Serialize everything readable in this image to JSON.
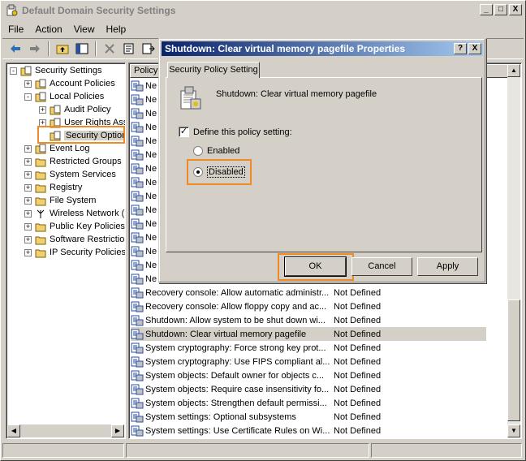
{
  "window": {
    "title": "Default Domain Security Settings",
    "min_label": "_",
    "max_label": "□",
    "close_label": "X"
  },
  "menu": [
    "File",
    "Action",
    "View",
    "Help"
  ],
  "tree": {
    "items": [
      {
        "label": "Security Settings",
        "level": 0,
        "expander": "-"
      },
      {
        "label": "Account Policies",
        "level": 1,
        "expander": "+"
      },
      {
        "label": "Local Policies",
        "level": 1,
        "expander": "-"
      },
      {
        "label": "Audit Policy",
        "level": 2,
        "expander": "+"
      },
      {
        "label": "User Rights Assig",
        "level": 2,
        "expander": "+"
      },
      {
        "label": "Security Options",
        "level": 2,
        "expander": ""
      },
      {
        "label": "Event Log",
        "level": 1,
        "expander": "+"
      },
      {
        "label": "Restricted Groups",
        "level": 1,
        "expander": "+"
      },
      {
        "label": "System Services",
        "level": 1,
        "expander": "+"
      },
      {
        "label": "Registry",
        "level": 1,
        "expander": "+"
      },
      {
        "label": "File System",
        "level": 1,
        "expander": "+"
      },
      {
        "label": "Wireless Network (IEE",
        "level": 1,
        "expander": "+"
      },
      {
        "label": "Public Key Policies",
        "level": 1,
        "expander": "+"
      },
      {
        "label": "Software Restriction I",
        "level": 1,
        "expander": "+"
      },
      {
        "label": "IP Security Policies on",
        "level": 1,
        "expander": "+"
      }
    ]
  },
  "list": {
    "header_policy": "Policy",
    "partial_label": "Ne",
    "partial_count": 15,
    "rows": [
      {
        "policy": "Recovery console: Allow automatic administr...",
        "setting": "Not Defined"
      },
      {
        "policy": "Recovery console: Allow floppy copy and ac...",
        "setting": "Not Defined"
      },
      {
        "policy": "Shutdown: Allow system to be shut down wi...",
        "setting": "Not Defined"
      },
      {
        "policy": "Shutdown: Clear virtual memory pagefile",
        "setting": "Not Defined",
        "selected": true
      },
      {
        "policy": "System cryptography: Force strong key prot...",
        "setting": "Not Defined"
      },
      {
        "policy": "System cryptography: Use FIPS compliant al...",
        "setting": "Not Defined"
      },
      {
        "policy": "System objects: Default owner for objects c...",
        "setting": "Not Defined"
      },
      {
        "policy": "System objects: Require case insensitivity fo...",
        "setting": "Not Defined"
      },
      {
        "policy": "System objects: Strengthen default permissi...",
        "setting": "Not Defined"
      },
      {
        "policy": "System settings: Optional subsystems",
        "setting": "Not Defined"
      },
      {
        "policy": "System settings: Use Certificate Rules on Wi...",
        "setting": "Not Defined"
      }
    ]
  },
  "dialog": {
    "title": "Shutdown: Clear virtual memory pagefile Properties",
    "help_label": "?",
    "close_label": "X",
    "tab_label": "Security Policy Setting",
    "policy_name": "Shutdown: Clear virtual memory pagefile",
    "define_label": "Define this policy setting:",
    "define_checked": true,
    "enabled_label": "Enabled",
    "disabled_label": "Disabled",
    "selected_option": "Disabled",
    "ok_label": "OK",
    "cancel_label": "Cancel",
    "apply_label": "Apply"
  },
  "colors": {
    "highlight": "#f08a24",
    "title_active_start": "#0a246a",
    "title_active_end": "#a6caf0",
    "face": "#d4d0c8"
  }
}
